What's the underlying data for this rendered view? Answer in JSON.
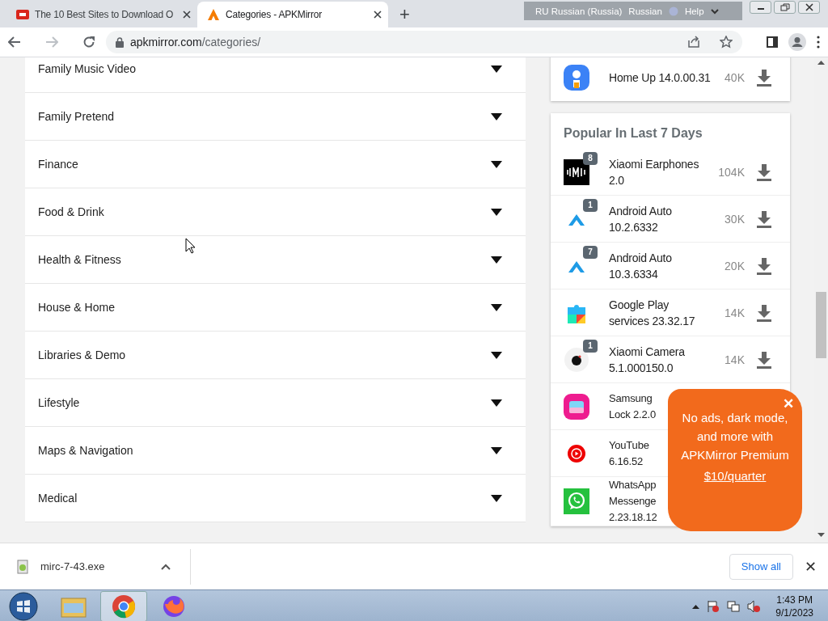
{
  "browser": {
    "tabs": [
      {
        "title": "The 10 Best Sites to Download O",
        "selected": false
      },
      {
        "title": "Categories - APKMirror",
        "selected": true
      }
    ],
    "new_tab": "+",
    "url_host": "apkmirror.com",
    "url_path": "/categories/"
  },
  "language_bar": {
    "language": "RU Russian (Russia)",
    "keyboard": "Russian",
    "help": "Help"
  },
  "categories": [
    {
      "label": "Family Music Video",
      "expanded": false
    },
    {
      "label": "Family Pretend",
      "expanded": false
    },
    {
      "label": "Finance",
      "expanded": false
    },
    {
      "label": "Food & Drink",
      "expanded": false
    },
    {
      "label": "Health & Fitness",
      "expanded": false
    },
    {
      "label": "House & Home",
      "expanded": false
    },
    {
      "label": "Libraries & Demo",
      "expanded": false
    },
    {
      "label": "Lifestyle",
      "expanded": false
    },
    {
      "label": "Maps & Navigation",
      "expanded": false
    },
    {
      "label": "Medical",
      "expanded": false
    }
  ],
  "latest_card": {
    "app": "Home Up 14.0.00.31",
    "downloads": "40K"
  },
  "popular": {
    "title": "Popular In Last 7 Days",
    "items": [
      {
        "name_lines": [
          "Xiaomi Earphones",
          "2.0"
        ],
        "comments": "8",
        "downloads": "104K"
      },
      {
        "name_lines": [
          "Android Auto",
          "10.2.6332"
        ],
        "comments": "1",
        "downloads": "30K"
      },
      {
        "name_lines": [
          "Android Auto",
          "10.3.6334"
        ],
        "comments": "7",
        "downloads": "20K"
      },
      {
        "name_lines": [
          "Google Play",
          "services 23.32.17"
        ],
        "downloads": "14K"
      },
      {
        "name_lines": [
          "Xiaomi Camera",
          "5.1.000150.0"
        ],
        "comments": "1",
        "downloads": "14K"
      },
      {
        "name_lines": [
          "Samsung",
          "Lock 2.2.0"
        ]
      },
      {
        "name_lines": [
          "YouTube",
          "6.16.52"
        ]
      },
      {
        "name_lines": [
          "WhatsApp",
          "Messenge",
          "2.23.18.12"
        ]
      }
    ]
  },
  "promo": {
    "close": "✕",
    "text": "No ads, dark mode, and more with APKMirror Premium",
    "link": "$10/quarter"
  },
  "downloads_bar": {
    "file": "mirc-7-43.exe",
    "show_all": "Show all",
    "close": "✕"
  },
  "taskbar": {
    "time": "1:43 PM",
    "date": "9/1/2023"
  }
}
